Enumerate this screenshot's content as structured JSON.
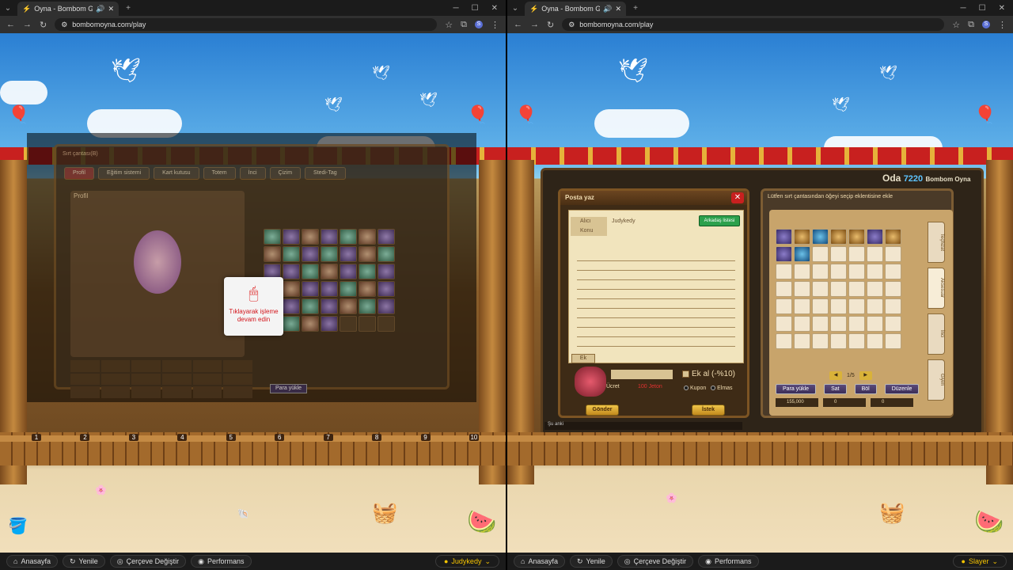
{
  "left": {
    "tab_title": "Oyna - Bombom Gizemler",
    "url": "bombomoyna.com/play",
    "game": {
      "bag_title": "Sırt çantası(B)",
      "tabs": [
        "Profil",
        "Eğitim sistemi",
        "Kart kutusu",
        "Totem",
        "İnci",
        "Çizim",
        "Stedi-Tag"
      ],
      "profile_label": "Profil",
      "click_prompt": "Tıklayarak işleme devam edin",
      "para_yukle": "Para yükle"
    },
    "footer_number_ticks": [
      "1",
      "2",
      "3",
      "4",
      "5",
      "6",
      "7",
      "8",
      "9",
      "10"
    ],
    "status": {
      "home": "Anasayfa",
      "refresh": "Yenile",
      "frame": "Çerçeve Değiştir",
      "perf": "Performans",
      "user": "Judykedy"
    }
  },
  "right": {
    "tab_title": "Oyna - Bombom Gizemler",
    "url": "bombomoyna.com/play",
    "game": {
      "room_label": "Oda",
      "room_number": "7220",
      "room_name": "Bombom Oyna",
      "mail": {
        "title": "Posta yaz",
        "to_label": "Alıcı",
        "to_value": "Judykedy",
        "subject_label": "Konu",
        "friend_list": "Arkadaş listesi",
        "ek_label": "Ek",
        "fee_label": "Ücret",
        "fee_value": "100 Jeton",
        "ek_al": "Ek al (-%10)",
        "kupon": "Kupon",
        "elmas": "Elmas",
        "send": "Gönder",
        "request": "İstek"
      },
      "bag": {
        "title": "Lütfen sırt çantasından öğeyi seçip eklentisine ekle",
        "page": "1/5",
        "btn_para": "Para yükle",
        "btn_sat": "Sat",
        "btn_bol": "Böl",
        "btn_duzenle": "Düzenle",
        "money": [
          "155,000",
          "0",
          "0"
        ],
        "side_tabs": [
          "Teçhizat",
          "Aksesuar",
          "İnci",
          "Giyim"
        ]
      },
      "chat_placeholder": "Şu anki"
    },
    "status": {
      "home": "Anasayfa",
      "refresh": "Yenile",
      "frame": "Çerçeve Değiştir",
      "perf": "Performans",
      "user": "Slayer"
    }
  },
  "colors": {
    "accent": "#f5c400",
    "danger": "#d3161c",
    "browser_bg": "#1f1f1f"
  }
}
